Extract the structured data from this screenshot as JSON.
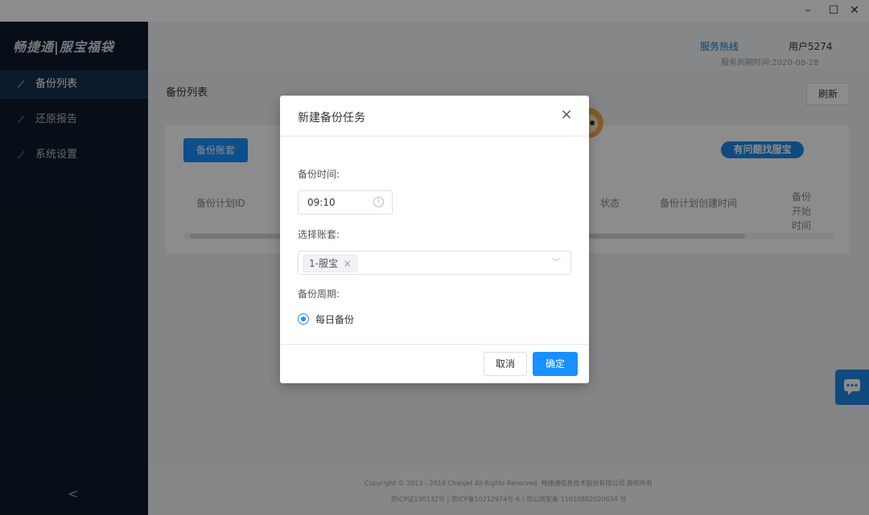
{
  "window": {
    "minimize_icon": "–",
    "maximize_icon": "☐",
    "close_icon": "✕"
  },
  "sidebar": {
    "logo": "畅捷通|服宝福袋",
    "items": [
      {
        "label": "备份列表",
        "icon": "chart-icon",
        "active": true
      },
      {
        "label": "还原报告",
        "icon": "chart-icon",
        "active": false
      },
      {
        "label": "系统设置",
        "icon": "chart-icon",
        "active": false
      }
    ],
    "collapse_icon": "<"
  },
  "header": {
    "hotline": "服务热线",
    "user": "用户5274",
    "expire": "服务到期时间:2020-08-28"
  },
  "main": {
    "title": "备份列表",
    "refresh_label": "刷新",
    "add_button": "备份账套",
    "columns": [
      "备份计划ID",
      "状态",
      "备份计划创建时间",
      "备份开始时间"
    ]
  },
  "help": {
    "label": "有问题找服宝"
  },
  "footer": {
    "line1": "Copyright © 2013 - 2019 Chanjet All Rights Reserved. 畅捷通信息技术股份有限公司 版权所有",
    "line2": "京ICP证130132号 | 京ICP备10212974号-6 | 京公网安备 11010802020634 号"
  },
  "dialog": {
    "title": "新建备份任务",
    "close_icon": "×",
    "time_label": "备份时间:",
    "time_value": "09:10",
    "account_label": "选择账套:",
    "account_tag": "1-服宝",
    "account_tag_remove": "×",
    "period_label": "备份周期:",
    "period_option": "每日备份",
    "cancel": "取消",
    "ok": "确定"
  },
  "colors": {
    "primary": "#1890ff",
    "sidebar_bg": "#0e1b2a",
    "overlay": "rgba(0,0,0,0.45)"
  }
}
